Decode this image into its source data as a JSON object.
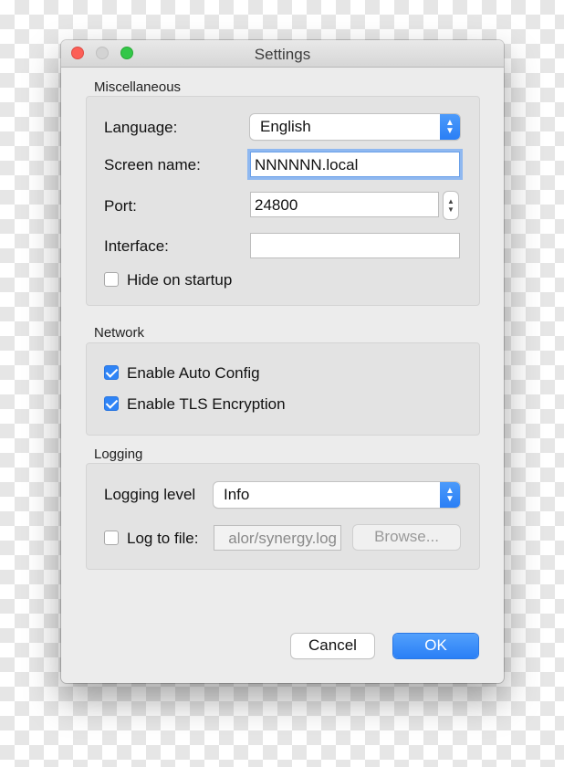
{
  "window": {
    "title": "Settings"
  },
  "misc": {
    "label": "Miscellaneous",
    "language_label": "Language:",
    "language_value": "English",
    "screen_name_label": "Screen name:",
    "screen_name_value": "NNNNNN.local",
    "port_label": "Port:",
    "port_value": "24800",
    "interface_label": "Interface:",
    "interface_value": "",
    "hide_on_startup_label": "Hide on startup",
    "hide_on_startup_checked": false
  },
  "network": {
    "label": "Network",
    "auto_config_label": "Enable Auto Config",
    "auto_config_checked": true,
    "tls_label": "Enable TLS Encryption",
    "tls_checked": true
  },
  "logging": {
    "label": "Logging",
    "level_label": "Logging level",
    "level_value": "Info",
    "log_to_file_label": "Log to file:",
    "log_to_file_checked": false,
    "log_file_path": "alor/synergy.log",
    "browse_label": "Browse..."
  },
  "buttons": {
    "cancel_label": "Cancel",
    "ok_label": "OK"
  },
  "colors": {
    "accent": "#2f84f6",
    "close": "#fc5f57",
    "zoom": "#33c748"
  }
}
